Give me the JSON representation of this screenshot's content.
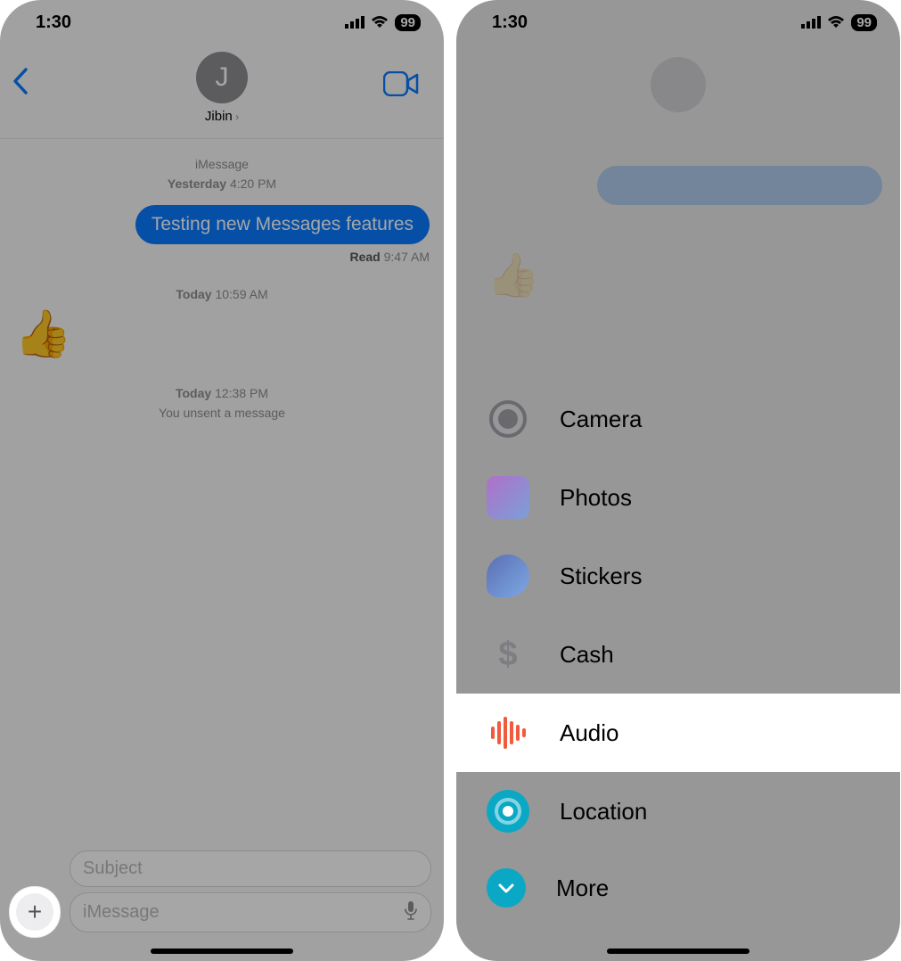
{
  "status": {
    "time": "1:30",
    "battery": "99"
  },
  "left": {
    "contact_initial": "J",
    "contact_name": "Jibin",
    "service_label": "iMessage",
    "day1": "Yesterday",
    "time1": "4:20 PM",
    "bubble1": "Testing new Messages features",
    "read_label": "Read",
    "read_time": "9:47 AM",
    "day2": "Today",
    "time2": "10:59 AM",
    "thumb": "👍",
    "day3": "Today",
    "time3": "12:38 PM",
    "unsent_label": "You unsent a message",
    "subject_placeholder": "Subject",
    "imessage_placeholder": "iMessage",
    "plus_glyph": "+"
  },
  "right": {
    "menu": {
      "camera": "Camera",
      "photos": "Photos",
      "stickers": "Stickers",
      "cash": "Cash",
      "audio": "Audio",
      "location": "Location",
      "more": "More",
      "cash_symbol": "$"
    }
  }
}
